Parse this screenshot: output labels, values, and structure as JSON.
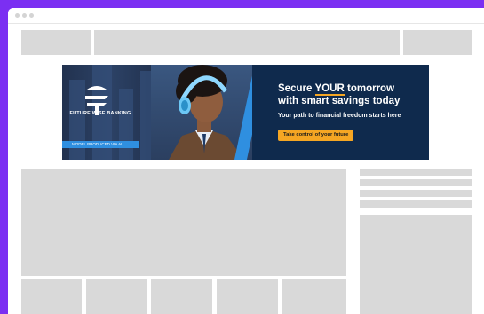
{
  "ad": {
    "headline_pre": "Secure ",
    "headline_emphasis": "YOUR",
    "headline_post": " tomorrow",
    "headline_line2": "with smart savings today",
    "subheadline": "Your path to financial freedom starts here",
    "cta_label": "Take control of your future",
    "brand": "FUTURE WISE BANKING",
    "ai_disclaimer": "MODEL PRODUCED VIA AI"
  },
  "colors": {
    "frame": "#7b2ff2",
    "placeholder": "#d9d9d9",
    "accent": "#f5a623",
    "ad_panel": "#0f2a4d",
    "ad_stripe": "#2f8fe0"
  },
  "icons": [
    "window-dot-icon",
    "brand-logo-icon",
    "person-with-headphones"
  ]
}
